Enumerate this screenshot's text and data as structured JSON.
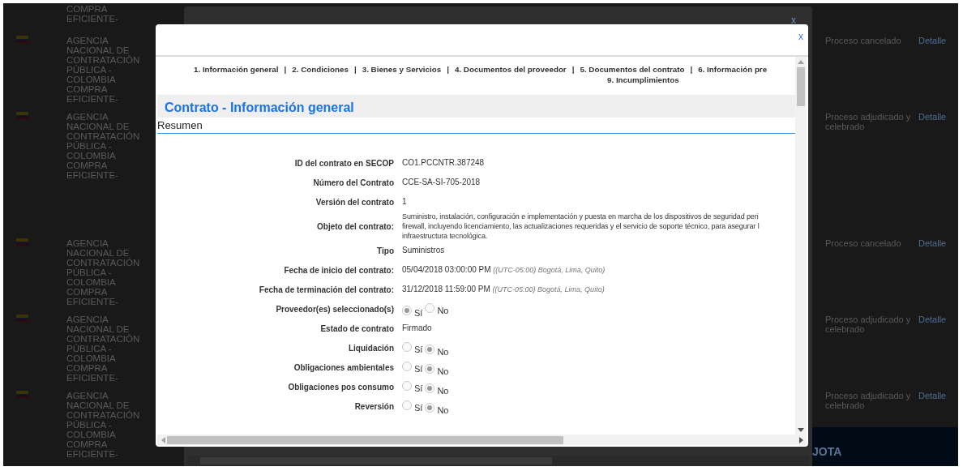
{
  "background_list": {
    "rows": [
      {
        "flag": false,
        "agency": "COMPRA EFICIENTE-"
      },
      {
        "flag": true,
        "agency": "AGENCIA NACIONAL DE CONTRATACIÓN PÚBLICA - COLOMBIA COMPRA EFICIENTE-",
        "status": "Proceso cancelado",
        "link": "Detalle"
      },
      {
        "flag": true,
        "agency": "AGENCIA NACIONAL DE CONTRATACIÓN PÚBLICA - COLOMBIA COMPRA EFICIENTE-",
        "status": "Proceso adjudicado y celebrado",
        "link": "Detalle"
      },
      {
        "flag": true,
        "agency": "AGENCIA NACIONAL DE CONTRATACIÓN PÚBLICA - COLOMBIA COMPRA EFICIENTE-",
        "status": "Proceso cancelado",
        "link": "Detalle"
      },
      {
        "flag": true,
        "agency": "AGENCIA NACIONAL DE CONTRATACIÓN PÚBLICA - COLOMBIA COMPRA EFICIENTE-",
        "status": "Proceso adjudicado y celebrado",
        "link": "Detalle"
      },
      {
        "flag": true,
        "agency": "AGENCIA NACIONAL DE CONTRATACIÓN PÚBLICA - COLOMBIA COMPRA EFICIENTE-",
        "status": "Proceso adjudicado y celebrado",
        "link": "Detalle"
      }
    ],
    "button": "JOTA"
  },
  "back_modal": {
    "close": "x"
  },
  "modal": {
    "close": "x",
    "nav": {
      "separator": "|",
      "links": [
        "1. Información general",
        "2. Condiciones",
        "3. Bienes y Servicios",
        "4. Documentos del proveedor",
        "5. Documentos del contrato",
        "6. Información pre",
        "9. Incumplimientos"
      ]
    },
    "title": "Contrato - Información general",
    "section": "Resumen",
    "fields": [
      {
        "kind": "text",
        "label": "ID del contrato en SECOP",
        "value": "CO1.PCCNTR.387248"
      },
      {
        "kind": "text",
        "label": "Número del Contrato",
        "value": "CCE-SA-SI-705-2018"
      },
      {
        "kind": "text",
        "label": "Versión del contrato",
        "value": "1"
      },
      {
        "kind": "lines",
        "label": "Objeto del contrato:",
        "lines": [
          "Suministro, instalación, configuración e implementación y puesta en marcha de los dispositivos de seguridad peri",
          "firewall, incluyendo licenciamiento, las actualizaciones requeridas y el servicio de soporte técnico, para asegurar l",
          "infraestructura tecnológica."
        ]
      },
      {
        "kind": "text",
        "label": "Tipo",
        "value": "Suministros"
      },
      {
        "kind": "date",
        "label": "Fecha de inicio del contrato:",
        "value": "05/04/2018 03:00:00 PM",
        "note": "((UTC-05:00) Bogotá, Lima, Quito)"
      },
      {
        "kind": "date",
        "label": "Fecha de terminación del contrato:",
        "value": "31/12/2018 11:59:00 PM",
        "note": "((UTC-05:00) Bogotá, Lima, Quito)"
      },
      {
        "kind": "radio",
        "label": "Proveedor(es) seleccionado(s)",
        "options": [
          {
            "label": "Sí",
            "selected": true
          },
          {
            "label": "No",
            "selected": false
          }
        ]
      },
      {
        "kind": "text",
        "label": "Estado de contrato",
        "value": "Firmado"
      },
      {
        "kind": "radio",
        "label": "Liquidación",
        "options": [
          {
            "label": "Sí",
            "selected": false
          },
          {
            "label": "No",
            "selected": true
          }
        ]
      },
      {
        "kind": "radio",
        "label": "Obligaciones ambientales",
        "options": [
          {
            "label": "Sí",
            "selected": false
          },
          {
            "label": "No",
            "selected": true
          }
        ]
      },
      {
        "kind": "radio",
        "label": "Obligaciones pos consumo",
        "options": [
          {
            "label": "Sí",
            "selected": false
          },
          {
            "label": "No",
            "selected": true
          }
        ]
      },
      {
        "kind": "radio",
        "label": "Reversión",
        "options": [
          {
            "label": "Sí",
            "selected": false
          },
          {
            "label": "No",
            "selected": true
          }
        ]
      }
    ]
  }
}
